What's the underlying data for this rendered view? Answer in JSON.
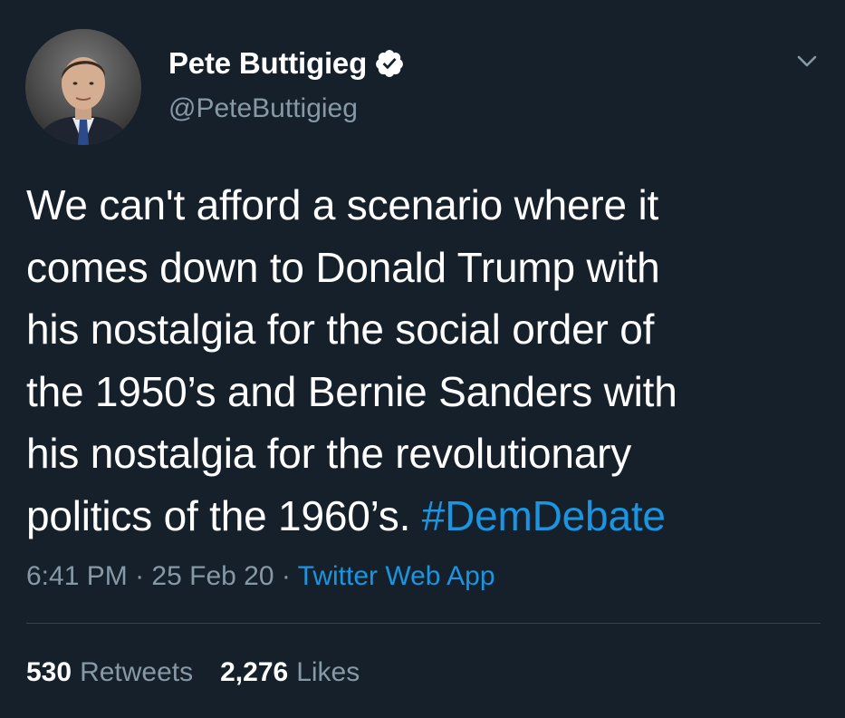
{
  "tweet": {
    "author": {
      "display_name": "Pete Buttigieg",
      "handle": "@PeteButtigieg",
      "verified": true,
      "avatar_icon": "profile-photo"
    },
    "body_lines": [
      "We can't afford a scenario where it",
      "comes down to Donald Trump with",
      "his nostalgia for the social order of",
      "the 1950’s and Bernie Sanders with",
      "his nostalgia for the revolutionary"
    ],
    "body_last_line_text": "politics of the 1960’s. ",
    "hashtag": "#DemDebate",
    "time": "6:41 PM",
    "date": "25 Feb 20",
    "separator": "·",
    "source": "Twitter Web App",
    "stats": {
      "retweets_count": "530",
      "retweets_label": "Retweets",
      "likes_count": "2,276",
      "likes_label": "Likes"
    },
    "colors": {
      "background": "#15202b",
      "text_primary": "#ffffff",
      "text_secondary": "#8899a6",
      "link": "#1b95e0",
      "divider": "#38444d"
    },
    "icons": {
      "verified": "verified-badge-icon",
      "more": "chevron-down-icon"
    }
  }
}
